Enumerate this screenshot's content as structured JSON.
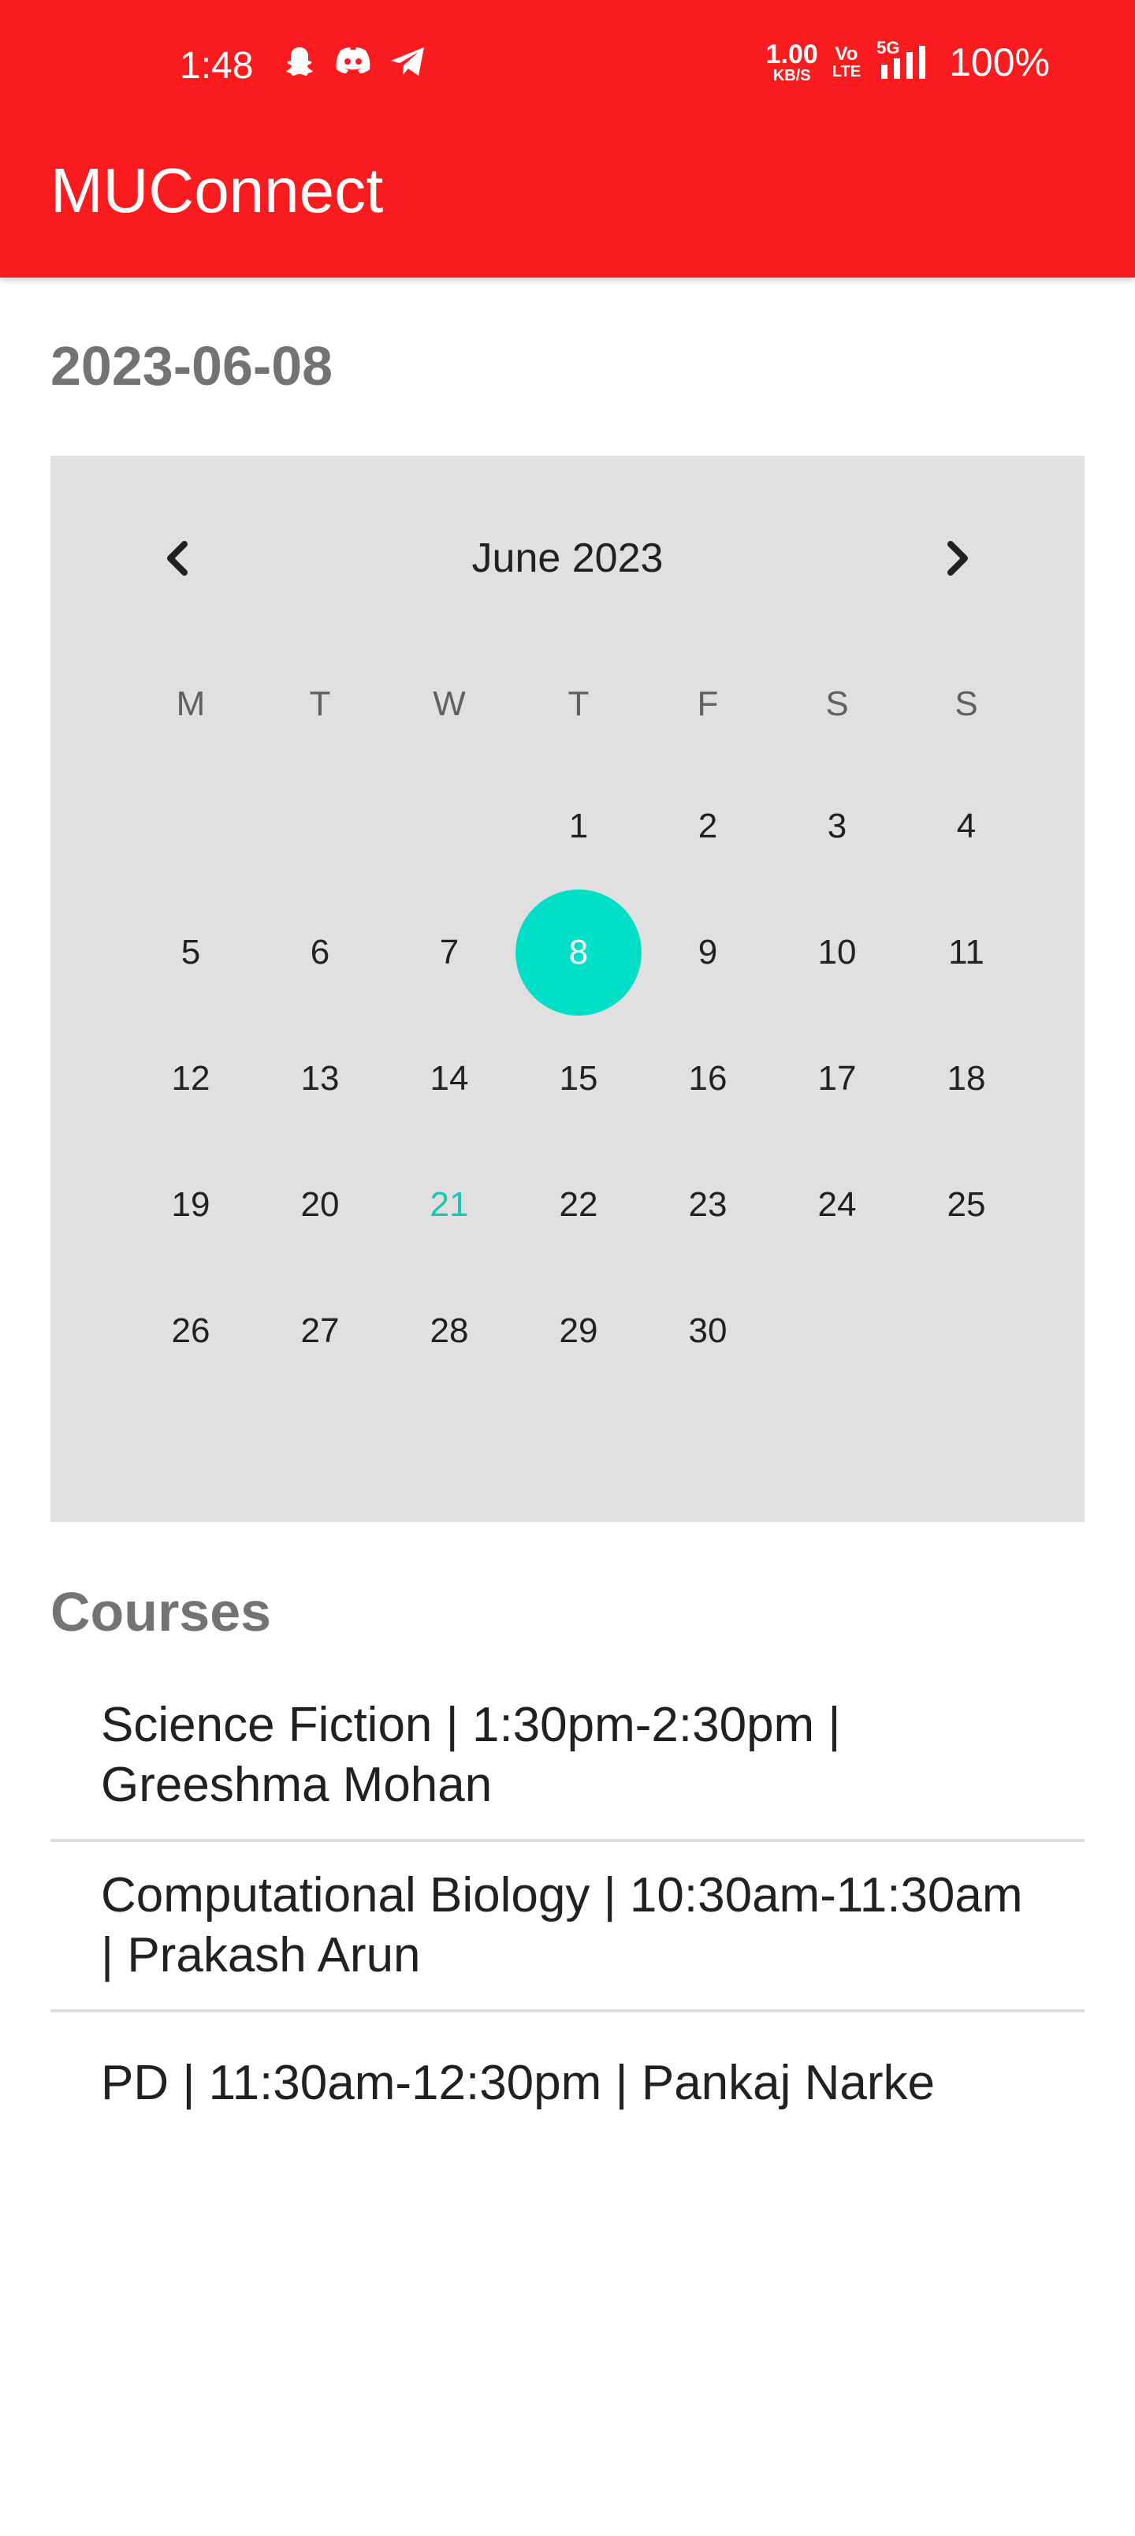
{
  "status_bar": {
    "time": "1:48",
    "icons_left": [
      "snapchat-icon",
      "discord-icon",
      "telegram-icon"
    ],
    "net_speed_value": "1.00",
    "net_speed_unit": "KB/S",
    "volte_top": "Vo",
    "volte_bottom": "LTE",
    "network_label": "5G",
    "battery": "100%"
  },
  "app_bar": {
    "title": "MUConnect",
    "color": "#fa1b1e"
  },
  "selected_date": "2023-06-08",
  "calendar": {
    "month_label": "June 2023",
    "prev_icon": "chevron-left-icon",
    "next_icon": "chevron-right-icon",
    "weekdays": [
      "M",
      "T",
      "W",
      "T",
      "F",
      "S",
      "S"
    ],
    "leading_blanks": 3,
    "days_in_month": 30,
    "selected_day": 8,
    "today": 21,
    "selected_color": "#02dfc9",
    "today_color": "#19c7b4",
    "background": "#e0e0e0"
  },
  "courses": {
    "title": "Courses",
    "items": [
      "Science Fiction | 1:30pm-2:30pm | Greeshma Mohan",
      "Computational Biology | 10:30am-11:30am | Prakash Arun",
      "PD | 11:30am-12:30pm | Pankaj Narke"
    ]
  }
}
